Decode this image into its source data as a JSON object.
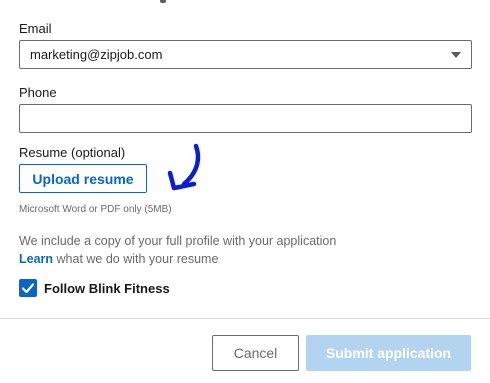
{
  "email": {
    "label": "Email",
    "selected_value": "marketing@zipjob.com"
  },
  "phone": {
    "label": "Phone",
    "value": "",
    "placeholder": ""
  },
  "resume": {
    "label": "Resume (optional)",
    "upload_label": "Upload resume",
    "hint": "Microsoft Word or PDF only (5MB)"
  },
  "info": {
    "line1": "We include a copy of your full profile with your application",
    "learn_link": "Learn",
    "line2_rest": " what we do with your resume"
  },
  "follow": {
    "label": "Follow Blink Fitness",
    "checked": true
  },
  "footer": {
    "cancel_label": "Cancel",
    "submit_label": "Submit application"
  },
  "colors": {
    "accent": "#0a66c2",
    "submit_disabled_bg": "#b3d4f0",
    "annotation_arrow": "#0a1ed8"
  },
  "icons": {
    "dropdown": "caret-down-icon",
    "checkbox": "checkmark-icon",
    "annotation": "hand-drawn-arrow-icon"
  }
}
